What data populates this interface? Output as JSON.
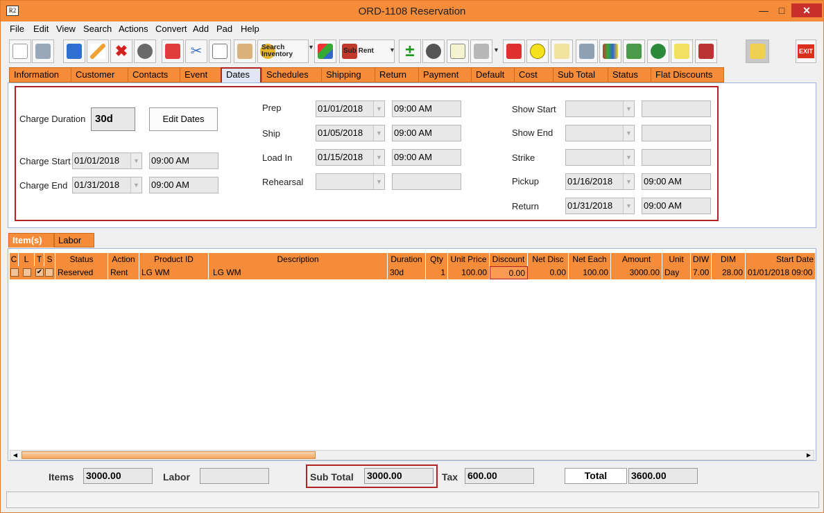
{
  "window": {
    "title": "ORD-1108 Reservation",
    "icon_text": "R2"
  },
  "menu": [
    "File",
    "Edit",
    "View",
    "Search",
    "Actions",
    "Convert",
    "Add",
    "Pad",
    "Help"
  ],
  "toolbar": {
    "search_inventory_label_1": "Search",
    "search_inventory_label_2": "Inventory",
    "sub_rent_label": "Sub Rent",
    "exit_label": "EXIT"
  },
  "tabs": [
    "Information",
    "Customer",
    "Contacts",
    "Event",
    "Dates",
    "Schedules",
    "Shipping",
    "Return",
    "Payment",
    "Default",
    "Cost",
    "Sub Total",
    "Status",
    "Flat Discounts"
  ],
  "active_tab": "Dates",
  "dates": {
    "charge_duration_label": "Charge Duration",
    "charge_duration": "30d",
    "edit_dates_label": "Edit Dates",
    "charge_start_label": "Charge Start",
    "charge_start_date": "01/01/2018",
    "charge_start_time": "09:00 AM",
    "charge_end_label": "Charge End",
    "charge_end_date": "01/31/2018",
    "charge_end_time": "09:00 AM",
    "prep_label": "Prep",
    "prep_date": "01/01/2018",
    "prep_time": "09:00 AM",
    "ship_label": "Ship",
    "ship_date": "01/05/2018",
    "ship_time": "09:00 AM",
    "load_in_label": "Load In",
    "load_in_date": "01/15/2018",
    "load_in_time": "09:00 AM",
    "rehearsal_label": "Rehearsal",
    "rehearsal_date": "",
    "rehearsal_time": "",
    "show_start_label": "Show Start",
    "show_start_date": "",
    "show_start_time": "",
    "show_end_label": "Show End",
    "show_end_date": "",
    "show_end_time": "",
    "strike_label": "Strike",
    "strike_date": "",
    "strike_time": "",
    "pickup_label": "Pickup",
    "pickup_date": "01/16/2018",
    "pickup_time": "09:00 AM",
    "return_label": "Return",
    "return_date": "01/31/2018",
    "return_time": "09:00 AM"
  },
  "subtabs": [
    "Item(s)",
    "Labor"
  ],
  "grid": {
    "columns": [
      "C",
      "L",
      "T",
      "S",
      "Status",
      "Action",
      "Product ID",
      "Description",
      "Duration",
      "Qty",
      "Unit Price",
      "Discount",
      "Net Disc",
      "Net Each",
      "Amount",
      "Unit",
      "DIW",
      "DIM",
      "Start Date"
    ],
    "rows": [
      {
        "c": "",
        "l": "",
        "t": "✔",
        "s": "",
        "status": "Reserved",
        "action": "Rent",
        "product_id": "LG WM",
        "description": "LG WM",
        "duration": "30d",
        "qty": "1",
        "unit_price": "100.00",
        "discount": "0.00",
        "net_disc": "0.00",
        "net_each": "100.00",
        "amount": "3000.00",
        "unit": "Day",
        "diw": "7.00",
        "dim": "28.00",
        "start_date": "01/01/2018 09:00"
      }
    ]
  },
  "totals": {
    "items_label": "Items",
    "items": "3000.00",
    "labor_label": "Labor",
    "labor": "",
    "sub_total_label": "Sub Total",
    "sub_total": "3000.00",
    "tax_label": "Tax",
    "tax": "600.00",
    "total_label": "Total",
    "total": "3600.00"
  },
  "colors": {
    "accent": "#f58c3a",
    "highlight": "#b22222"
  }
}
